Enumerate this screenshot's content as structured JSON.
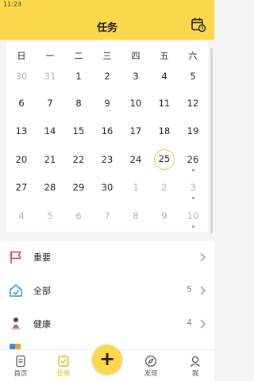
{
  "status_bar": {
    "time": "11:23"
  },
  "header": {
    "title": "任务",
    "calendar_button_icon": "calendar-clock-icon"
  },
  "calendar": {
    "weekdays": [
      "日",
      "一",
      "二",
      "三",
      "四",
      "五",
      "六"
    ],
    "weeks": [
      [
        {
          "day": "30",
          "muted": true
        },
        {
          "day": "31",
          "muted": true
        },
        {
          "day": "1"
        },
        {
          "day": "2"
        },
        {
          "day": "3"
        },
        {
          "day": "4"
        },
        {
          "day": "5"
        }
      ],
      [
        {
          "day": "6"
        },
        {
          "day": "7"
        },
        {
          "day": "8"
        },
        {
          "day": "9"
        },
        {
          "day": "10"
        },
        {
          "day": "11"
        },
        {
          "day": "12"
        }
      ],
      [
        {
          "day": "13"
        },
        {
          "day": "14"
        },
        {
          "day": "15"
        },
        {
          "day": "16"
        },
        {
          "day": "17"
        },
        {
          "day": "18"
        },
        {
          "day": "19"
        }
      ],
      [
        {
          "day": "20"
        },
        {
          "day": "21"
        },
        {
          "day": "22"
        },
        {
          "day": "23"
        },
        {
          "day": "24"
        },
        {
          "day": "25",
          "today": true
        },
        {
          "day": "26",
          "dot": true
        }
      ],
      [
        {
          "day": "27"
        },
        {
          "day": "28"
        },
        {
          "day": "29"
        },
        {
          "day": "30"
        },
        {
          "day": "1",
          "muted": true
        },
        {
          "day": "2",
          "muted": true
        },
        {
          "day": "3",
          "muted": true,
          "dot": true
        }
      ],
      [
        {
          "day": "4",
          "muted": true
        },
        {
          "day": "5",
          "muted": true
        },
        {
          "day": "6",
          "muted": true
        },
        {
          "day": "7",
          "muted": true
        },
        {
          "day": "8",
          "muted": true
        },
        {
          "day": "9",
          "muted": true
        },
        {
          "day": "10",
          "muted": true,
          "dot": true
        }
      ]
    ]
  },
  "task_lists": [
    {
      "label": "重要",
      "count": "",
      "icon": "flag-icon"
    },
    {
      "label": "全部",
      "count": "5",
      "icon": "home-icon"
    },
    {
      "label": "健康",
      "count": "4",
      "icon": "meditation-icon"
    }
  ],
  "tab_bar": {
    "tabs": [
      {
        "label": "首页",
        "icon": "document-icon",
        "active": false
      },
      {
        "label": "任务",
        "icon": "task-check-icon",
        "active": true
      },
      {
        "label": "发现",
        "icon": "compass-icon",
        "active": false
      },
      {
        "label": "我",
        "icon": "profile-icon",
        "active": false
      }
    ],
    "add_button_label": "+"
  },
  "colors": {
    "accent": "#fdd84a",
    "accent_text": "#f2b400",
    "today_ring": "#f2c530",
    "muted_text": "#b3b3b3"
  }
}
